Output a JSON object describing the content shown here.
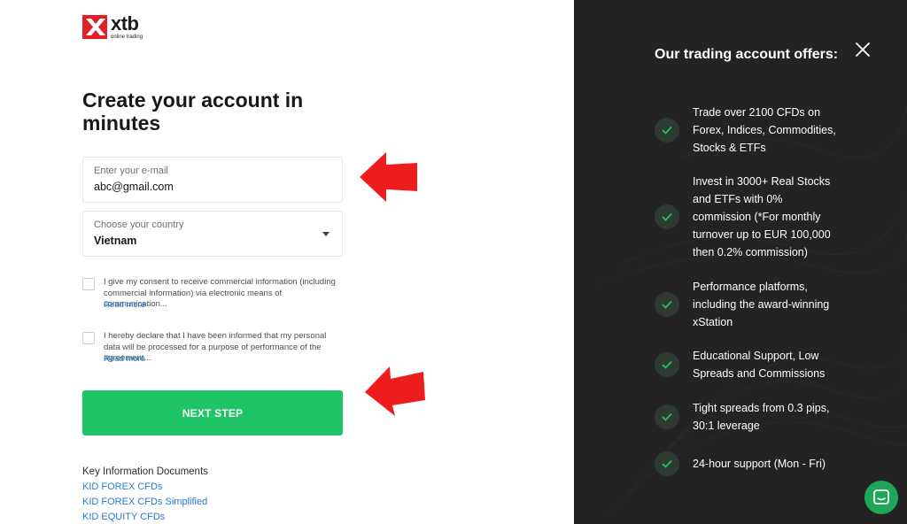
{
  "logo": {
    "name": "xtb",
    "subtitle": "online trading",
    "brand_color": "#e11f26"
  },
  "form": {
    "title": "Create your account in minutes",
    "email": {
      "label": "Enter your e-mail",
      "value": "abc@gmail.com"
    },
    "country": {
      "label": "Choose your country",
      "value": "Vietnam"
    },
    "consents": [
      {
        "text": "I give my consent to receive commercial information (including commercial information) via electronic means of communication...",
        "read_more": "Read more"
      },
      {
        "text": "I hereby declare that I have been informed that my personal data will be processed for a purpose of performance of the agreement...",
        "read_more": "Read more"
      }
    ],
    "next_button": "NEXT STEP",
    "button_color": "#1fc466"
  },
  "kid": {
    "title": "Key Information Documents",
    "links": [
      "KID FOREX CFDs",
      "KID FOREX CFDs Simplified",
      "KID EQUITY CFDs"
    ]
  },
  "offers_panel": {
    "title": "Our trading account offers:",
    "items": [
      "Trade over 2100 CFDs on Forex, Indices, Commodities, Stocks & ETFs",
      "Invest in 3000+ Real Stocks and ETFs with 0% commission (*For monthly turnover up to EUR 100,000 then 0.2% commission)",
      "Performance platforms, including the award-winning xStation",
      "Educational Support, Low Spreads and Commissions",
      "Tight spreads from 0.3 pips, 30:1 leverage",
      "24-hour support (Mon - Fri)"
    ],
    "background": "#232323",
    "check_color": "#1fc466"
  },
  "icons": {
    "close": "close-icon",
    "check": "check-icon",
    "chat": "chat-icon",
    "dropdown": "chevron-down-icon",
    "arrow": "red-arrow-icon"
  }
}
